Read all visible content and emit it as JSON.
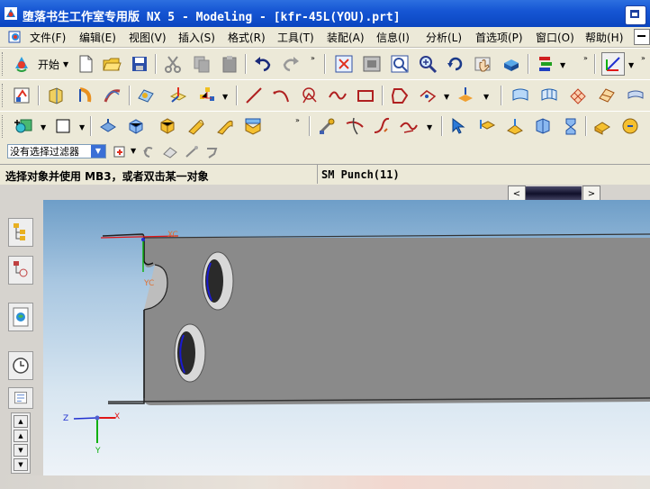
{
  "window": {
    "title": "堕落书生工作室专用版 NX 5 - Modeling - [kfr-45L(YOU).prt]"
  },
  "menu": [
    {
      "label": "文件(F)"
    },
    {
      "label": "编辑(E)"
    },
    {
      "label": "视图(V)"
    },
    {
      "label": "插入(S)"
    },
    {
      "label": "格式(R)"
    },
    {
      "label": "工具(T)"
    },
    {
      "label": "装配(A)"
    },
    {
      "label": "信息(I)"
    },
    {
      "label": "分析(L)"
    },
    {
      "label": "首选项(P)"
    },
    {
      "label": "窗口(O)"
    },
    {
      "label": "帮助(H)"
    }
  ],
  "toolbar": {
    "start_label": "开始"
  },
  "filter": {
    "selected": "没有选择过滤器"
  },
  "status": {
    "prompt": "选择对象并使用 MB3，或者双击某一对象",
    "info": "SM Punch(11)"
  },
  "viewport": {
    "labels": {
      "xc": "XC",
      "yc": "YC",
      "axis_x": "X",
      "axis_y": "Y",
      "axis_z": "Z"
    }
  },
  "colors": {
    "title_bar": "#1656d4",
    "part_fill": "#8a8a8a",
    "axis_red": "#e01818",
    "axis_green": "#10b010",
    "axis_blue": "#2030d0",
    "edge_blue": "#1a1ad0"
  }
}
